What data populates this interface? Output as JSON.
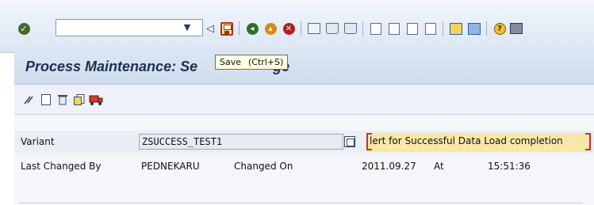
{
  "toolbar": {
    "command_field_value": "",
    "icons": [
      "check-icon",
      "dropdown-icon",
      "back-arrow-icon",
      "save-icon",
      "back-icon",
      "exit-icon",
      "cancel-icon",
      "print-icon",
      "find-icon",
      "find-next-icon",
      "first-page-icon",
      "previous-page-icon",
      "next-page-icon",
      "last-page-icon",
      "create-session-icon",
      "shortcut-icon",
      "help-icon",
      "customize-icon"
    ]
  },
  "title": {
    "left_text": "Process Maintenance: Se",
    "right_text": "ge"
  },
  "tooltip": {
    "label": "Save",
    "shortcut": "(Ctrl+S)"
  },
  "app_toolbar": {
    "icons": [
      "display-change-icon",
      "create-icon",
      "delete-icon",
      "copy-icon",
      "transport-icon"
    ]
  },
  "form": {
    "variant_label": "Variant",
    "variant_value": "ZSUCCESS_TEST1",
    "variant_description": "lert for Successful Data Load completion",
    "last_changed_by_label": "Last Changed By",
    "last_changed_by_value": "PEDNEKARU",
    "changed_on_label": "Changed On",
    "changed_on_value": "2011.09.27",
    "at_label": "At",
    "at_value": "15:51:36"
  },
  "colors": {
    "title_text": "#1d2f4c",
    "save_icon_border": "#c2281e",
    "description_highlight": "#f8e8a8"
  }
}
